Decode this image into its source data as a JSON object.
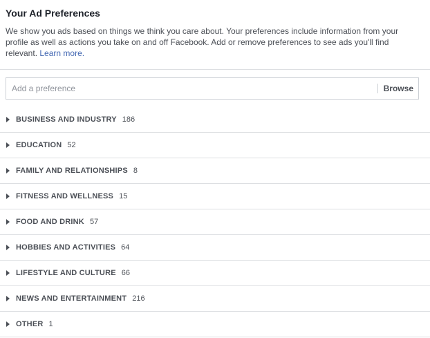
{
  "header": {
    "title": "Your Ad Preferences",
    "description": "We show you ads based on things we think you care about. Your preferences include information from your profile as well as actions you take on and off Facebook. Add or remove preferences to see ads you'll find relevant.",
    "learn_more": "Learn more."
  },
  "search": {
    "placeholder": "Add a preference",
    "browse_label": "Browse"
  },
  "categories": [
    {
      "label": "BUSINESS AND INDUSTRY",
      "count": "186"
    },
    {
      "label": "EDUCATION",
      "count": "52"
    },
    {
      "label": "FAMILY AND RELATIONSHIPS",
      "count": "8"
    },
    {
      "label": "FITNESS AND WELLNESS",
      "count": "15"
    },
    {
      "label": "FOOD AND DRINK",
      "count": "57"
    },
    {
      "label": "HOBBIES AND ACTIVITIES",
      "count": "64"
    },
    {
      "label": "LIFESTYLE AND CULTURE",
      "count": "66"
    },
    {
      "label": "NEWS AND ENTERTAINMENT",
      "count": "216"
    },
    {
      "label": "OTHER",
      "count": "1"
    }
  ],
  "colors": {
    "link": "#4267b2",
    "text": "#1d2129",
    "muted_text": "#4b4f56",
    "divider": "#dddfe2"
  },
  "icons": {
    "expand": "caret-right-icon"
  }
}
